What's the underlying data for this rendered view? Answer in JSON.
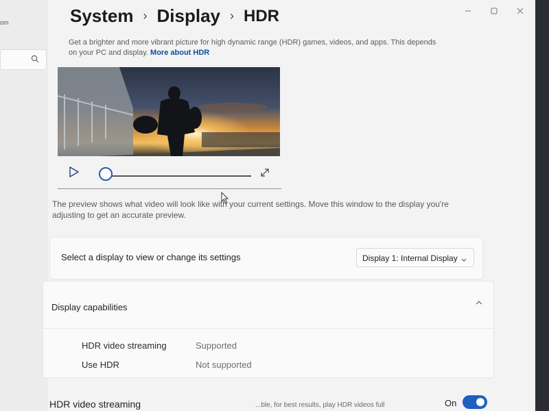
{
  "window": {
    "controls": [
      "minimize-icon",
      "maximize-icon",
      "close-icon"
    ]
  },
  "sidebar": {
    "partial_text": "om",
    "search_icon": "search-icon"
  },
  "breadcrumb": {
    "items": [
      "System",
      "Display"
    ],
    "current": "HDR"
  },
  "description": {
    "text": "Get a brighter and more vibrant picture for high dynamic range (HDR) games, videos, and apps. This depends on your PC and display.",
    "link": "More about HDR"
  },
  "preview": {
    "note": "The preview shows what video will look like with your current settings. Move this window to the display you're adjusting to get an accurate preview.",
    "progress": 0,
    "icons": [
      "play-icon",
      "expand-icon"
    ]
  },
  "display_select": {
    "label": "Select a display to view or change its settings",
    "selected": "Display 1: Internal Display"
  },
  "capabilities": {
    "header": "Display capabilities",
    "rows": [
      {
        "name": "HDR video streaming",
        "value": "Supported"
      },
      {
        "name": "Use HDR",
        "value": "Not supported"
      }
    ]
  },
  "hdr_streaming": {
    "label": "HDR video streaming",
    "desc": "...ble, for best results, play HDR videos full",
    "state": "On",
    "enabled": true
  },
  "colors": {
    "accent": "#1f5fbf",
    "link": "#0a4f9e",
    "background": "#f3f3f3",
    "card": "#fafafa"
  }
}
